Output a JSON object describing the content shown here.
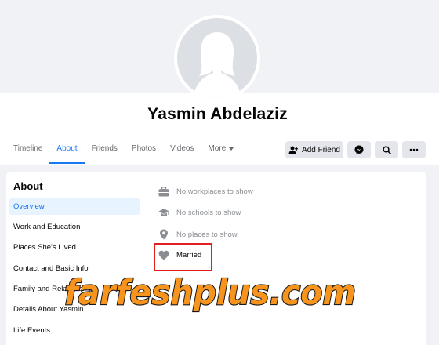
{
  "profile": {
    "name": "Yasmin Abdelaziz"
  },
  "tabs": [
    {
      "label": "Timeline",
      "active": false
    },
    {
      "label": "About",
      "active": true
    },
    {
      "label": "Friends",
      "active": false
    },
    {
      "label": "Photos",
      "active": false
    },
    {
      "label": "Videos",
      "active": false
    },
    {
      "label": "More",
      "active": false
    }
  ],
  "actions": {
    "add_friend": "Add Friend",
    "messenger_icon": "messenger-icon",
    "search_icon": "search-icon",
    "more_icon": "ellipsis-icon"
  },
  "about": {
    "title": "About",
    "items": [
      {
        "label": "Overview",
        "active": true
      },
      {
        "label": "Work and Education",
        "active": false
      },
      {
        "label": "Places She's Lived",
        "active": false
      },
      {
        "label": "Contact and Basic Info",
        "active": false
      },
      {
        "label": "Family and Relationships",
        "active": false
      },
      {
        "label": "Details About Yasmin",
        "active": false
      },
      {
        "label": "Life Events",
        "active": false
      }
    ]
  },
  "overview": {
    "rows": [
      {
        "icon": "briefcase-icon",
        "text": "No workplaces to show"
      },
      {
        "icon": "graduation-cap-icon",
        "text": "No schools to show"
      },
      {
        "icon": "location-pin-icon",
        "text": "No places to show"
      },
      {
        "icon": "heart-icon",
        "text": "Married"
      }
    ]
  },
  "watermark": {
    "text": "farfeshplus.com"
  },
  "colors": {
    "accent": "#1877f2",
    "highlight_box": "#e01e1e",
    "watermark_fill": "#f7941d",
    "watermark_outline": "#1a1a1a"
  }
}
